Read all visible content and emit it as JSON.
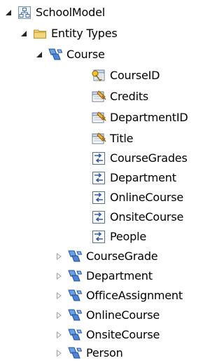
{
  "tree": {
    "root": {
      "label": "SchoolModel",
      "icon": "model-icon",
      "state": "expanded"
    },
    "entity_types": {
      "label": "Entity Types",
      "icon": "folder-icon",
      "state": "expanded"
    },
    "course": {
      "label": "Course",
      "icon": "entity-icon",
      "state": "expanded",
      "key_property": {
        "label": "CourseID",
        "icon": "key-property-icon"
      },
      "properties": [
        {
          "label": "Credits",
          "icon": "property-icon"
        },
        {
          "label": "DepartmentID",
          "icon": "property-icon"
        },
        {
          "label": "Title",
          "icon": "property-icon"
        }
      ],
      "navigation_properties": [
        {
          "label": "CourseGrades",
          "icon": "navigation-property-icon"
        },
        {
          "label": "Department",
          "icon": "navigation-property-icon"
        },
        {
          "label": "OnlineCourse",
          "icon": "navigation-property-icon"
        },
        {
          "label": "OnsiteCourse",
          "icon": "navigation-property-icon"
        },
        {
          "label": "People",
          "icon": "navigation-property-icon"
        }
      ]
    },
    "collapsed_entities": [
      {
        "label": "CourseGrade",
        "icon": "entity-icon",
        "state": "collapsed"
      },
      {
        "label": "Department",
        "icon": "entity-icon",
        "state": "collapsed"
      },
      {
        "label": "OfficeAssignment",
        "icon": "entity-icon",
        "state": "collapsed"
      },
      {
        "label": "OnlineCourse",
        "icon": "entity-icon",
        "state": "collapsed"
      },
      {
        "label": "OnsiteCourse",
        "icon": "entity-icon",
        "state": "collapsed"
      },
      {
        "label": "Person",
        "icon": "entity-icon",
        "state": "collapsed"
      }
    ]
  },
  "colors": {
    "expander_expanded": "#262626",
    "expander_collapsed": "#a0a0a0",
    "folder": "#e8c24a",
    "entity_blue": "#2f6fcf",
    "key_gold": "#d4a017",
    "navigation_blue": "#3a64b0"
  }
}
